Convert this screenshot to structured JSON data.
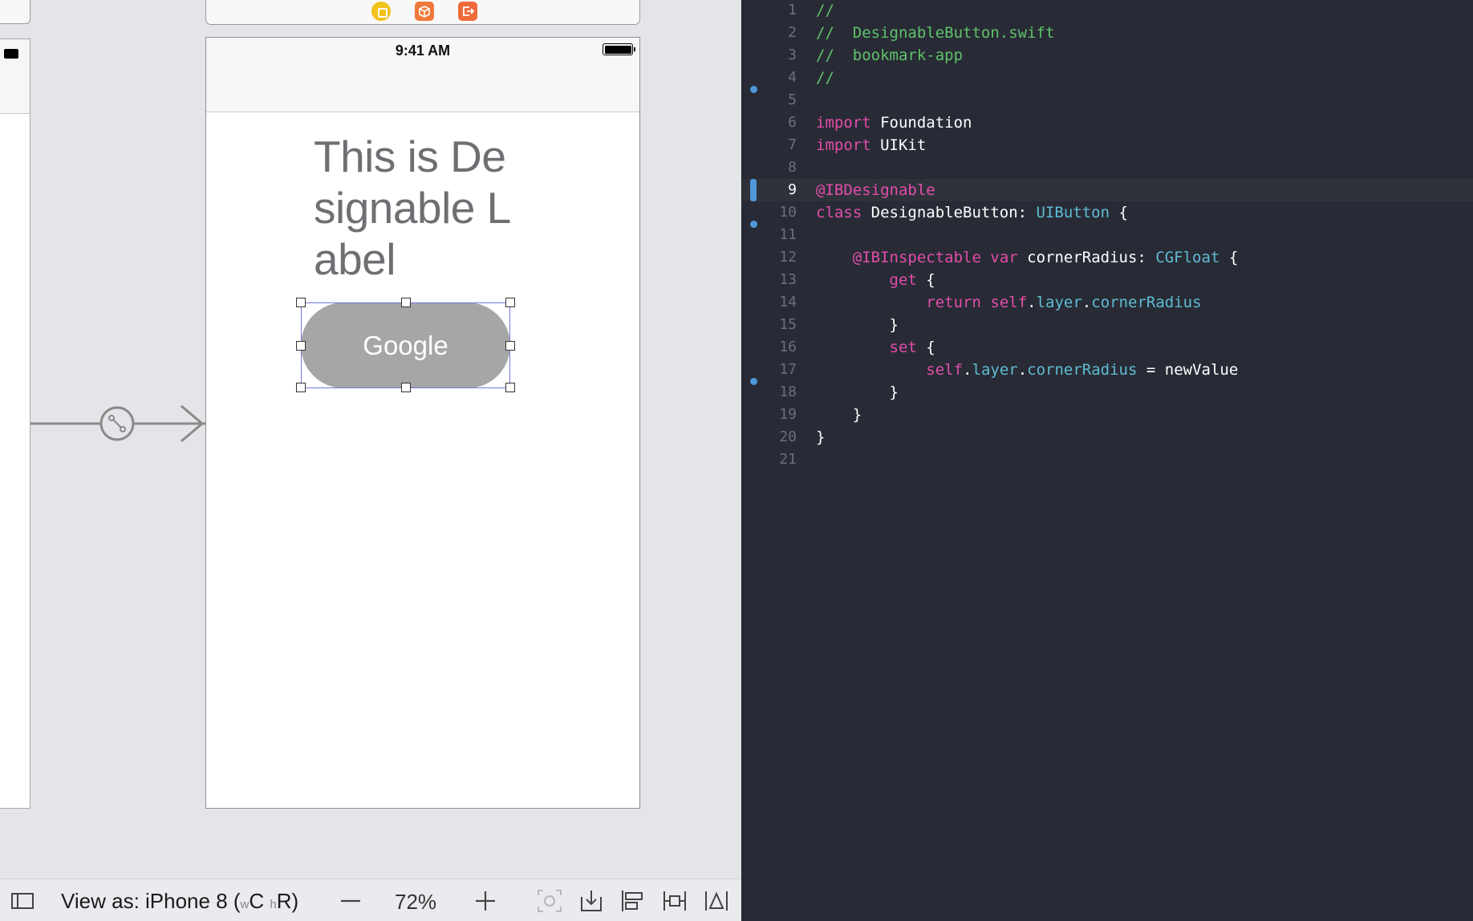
{
  "canvas": {
    "status_time": "9:41 AM",
    "label_text": "This is Designable Label",
    "button_title": "Google"
  },
  "toolbar": {
    "view_as_prefix": "View as: iPhone 8 (",
    "view_as_w": "w",
    "view_as_c": "C",
    "view_as_h": "h",
    "view_as_r": "R)",
    "zoom_level": "72%",
    "icons": [
      "sidebar-toggle-icon",
      "zoom-out-icon",
      "zoom-in-icon",
      "update-frames-icon",
      "embed-in-icon",
      "align-icon",
      "pin-icon",
      "resolve-issues-icon"
    ]
  },
  "editor": {
    "current_line": 9,
    "breakpoint_dots_after_lines": [
      4,
      10,
      17
    ],
    "lines": [
      {
        "n": "1",
        "tokens": [
          {
            "c": "cmt",
            "t": "//"
          }
        ]
      },
      {
        "n": "2",
        "tokens": [
          {
            "c": "cmt",
            "t": "//  DesignableButton.swift"
          }
        ]
      },
      {
        "n": "3",
        "tokens": [
          {
            "c": "cmt",
            "t": "//  bookmark-app"
          }
        ]
      },
      {
        "n": "4",
        "tokens": [
          {
            "c": "cmt",
            "t": "//"
          }
        ]
      },
      {
        "n": "5",
        "tokens": []
      },
      {
        "n": "6",
        "tokens": [
          {
            "c": "kw",
            "t": "import"
          },
          {
            "c": "",
            "t": " Foundation"
          }
        ]
      },
      {
        "n": "7",
        "tokens": [
          {
            "c": "kw",
            "t": "import"
          },
          {
            "c": "",
            "t": " UIKit"
          }
        ]
      },
      {
        "n": "8",
        "tokens": []
      },
      {
        "n": "9",
        "tokens": [
          {
            "c": "kw",
            "t": "@IBDesignable"
          }
        ]
      },
      {
        "n": "10",
        "tokens": [
          {
            "c": "kw",
            "t": "class"
          },
          {
            "c": "",
            "t": " DesignableButton: "
          },
          {
            "c": "typ",
            "t": "UIButton"
          },
          {
            "c": "",
            "t": " {"
          }
        ]
      },
      {
        "n": "11",
        "tokens": []
      },
      {
        "n": "12",
        "tokens": [
          {
            "c": "",
            "t": "    "
          },
          {
            "c": "kw",
            "t": "@IBInspectable"
          },
          {
            "c": "",
            "t": " "
          },
          {
            "c": "kw",
            "t": "var"
          },
          {
            "c": "",
            "t": " cornerRadius: "
          },
          {
            "c": "typ",
            "t": "CGFloat"
          },
          {
            "c": "",
            "t": " {"
          }
        ]
      },
      {
        "n": "13",
        "tokens": [
          {
            "c": "",
            "t": "        "
          },
          {
            "c": "kw",
            "t": "get"
          },
          {
            "c": "",
            "t": " {"
          }
        ]
      },
      {
        "n": "14",
        "tokens": [
          {
            "c": "",
            "t": "            "
          },
          {
            "c": "kw",
            "t": "return"
          },
          {
            "c": "",
            "t": " "
          },
          {
            "c": "kw",
            "t": "self"
          },
          {
            "c": "",
            "t": "."
          },
          {
            "c": "prop",
            "t": "layer"
          },
          {
            "c": "",
            "t": "."
          },
          {
            "c": "prop",
            "t": "cornerRadius"
          }
        ]
      },
      {
        "n": "15",
        "tokens": [
          {
            "c": "",
            "t": "        }"
          }
        ]
      },
      {
        "n": "16",
        "tokens": [
          {
            "c": "",
            "t": "        "
          },
          {
            "c": "kw",
            "t": "set"
          },
          {
            "c": "",
            "t": " {"
          }
        ]
      },
      {
        "n": "17",
        "tokens": [
          {
            "c": "",
            "t": "            "
          },
          {
            "c": "kw",
            "t": "self"
          },
          {
            "c": "",
            "t": "."
          },
          {
            "c": "prop",
            "t": "layer"
          },
          {
            "c": "",
            "t": "."
          },
          {
            "c": "prop",
            "t": "cornerRadius"
          },
          {
            "c": "",
            "t": " = newValue"
          }
        ]
      },
      {
        "n": "18",
        "tokens": [
          {
            "c": "",
            "t": "        }"
          }
        ]
      },
      {
        "n": "19",
        "tokens": [
          {
            "c": "",
            "t": "    }"
          }
        ]
      },
      {
        "n": "20",
        "tokens": [
          {
            "c": "",
            "t": "}"
          }
        ]
      },
      {
        "n": "21",
        "tokens": []
      }
    ]
  },
  "colors": {
    "editor_bg": "#282b35",
    "comment": "#5ec26a",
    "keyword": "#e24dab",
    "type": "#5fbcd3",
    "breakpoint": "#4f97d9",
    "selection": "#7478e0"
  }
}
